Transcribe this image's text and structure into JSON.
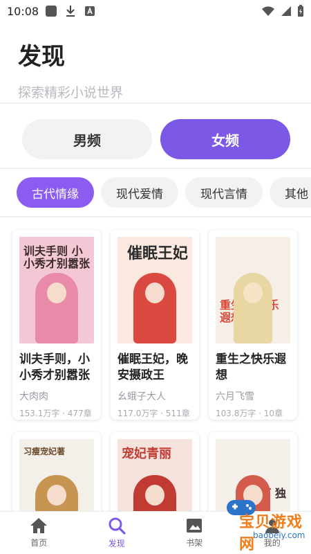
{
  "status": {
    "time": "10:08"
  },
  "header": {
    "title": "发现",
    "subtitle": "探索精彩小说世界"
  },
  "gender_tabs": [
    {
      "label": "男频",
      "active": false
    },
    {
      "label": "女频",
      "active": true
    }
  ],
  "categories": [
    {
      "label": "古代情缘",
      "active": true
    },
    {
      "label": "现代爱情",
      "active": false
    },
    {
      "label": "现代言情",
      "active": false
    },
    {
      "label": "其他",
      "active": false
    }
  ],
  "books": [
    {
      "title": "训夫手则，小小秀才别嚣张",
      "author": "大肉肉",
      "meta": "153.1万字 · 477章",
      "cover_text": "训夫手则 小小秀才别嚣张",
      "colors": {
        "bg": "#f3c7d3",
        "accent": "#e98aa8"
      }
    },
    {
      "title": "催眠王妃，晚安摄政王",
      "author": "幺蛾子大人",
      "meta": "117.0万字 · 511章",
      "cover_text": "催眠王妃",
      "colors": {
        "bg": "#fbe9e0",
        "accent": "#d9493f"
      }
    },
    {
      "title": "重生之快乐遐想",
      "author": "六月飞雪",
      "meta": "103.8万字 · 10章",
      "cover_text": "重生之 快乐 遐想",
      "colors": {
        "bg": "#f6efe7",
        "accent": "#d94738"
      }
    },
    {
      "title": "",
      "author": "",
      "meta": "",
      "cover_text": "习瘦宠妃著",
      "colors": {
        "bg": "#f3efe9",
        "accent": "#c79552"
      }
    },
    {
      "title": "",
      "author": "",
      "meta": "",
      "cover_text": "宠妃青丽",
      "colors": {
        "bg": "#f5e2dd",
        "accent": "#c23b33"
      }
    },
    {
      "title": "",
      "author": "",
      "meta": "",
      "cover_text": "下 独",
      "colors": {
        "bg": "#f6f0ea",
        "accent": "#d45a4c"
      }
    }
  ],
  "bottom_nav": [
    {
      "label": "首页",
      "icon": "home-icon",
      "active": false
    },
    {
      "label": "发现",
      "icon": "search-icon",
      "active": true
    },
    {
      "label": "书架",
      "icon": "bookshelf-icon",
      "active": false
    },
    {
      "label": "我的",
      "icon": "profile-icon",
      "active": false
    }
  ],
  "watermark": {
    "text": "宝贝游戏网",
    "url": "baobeiy.com"
  }
}
